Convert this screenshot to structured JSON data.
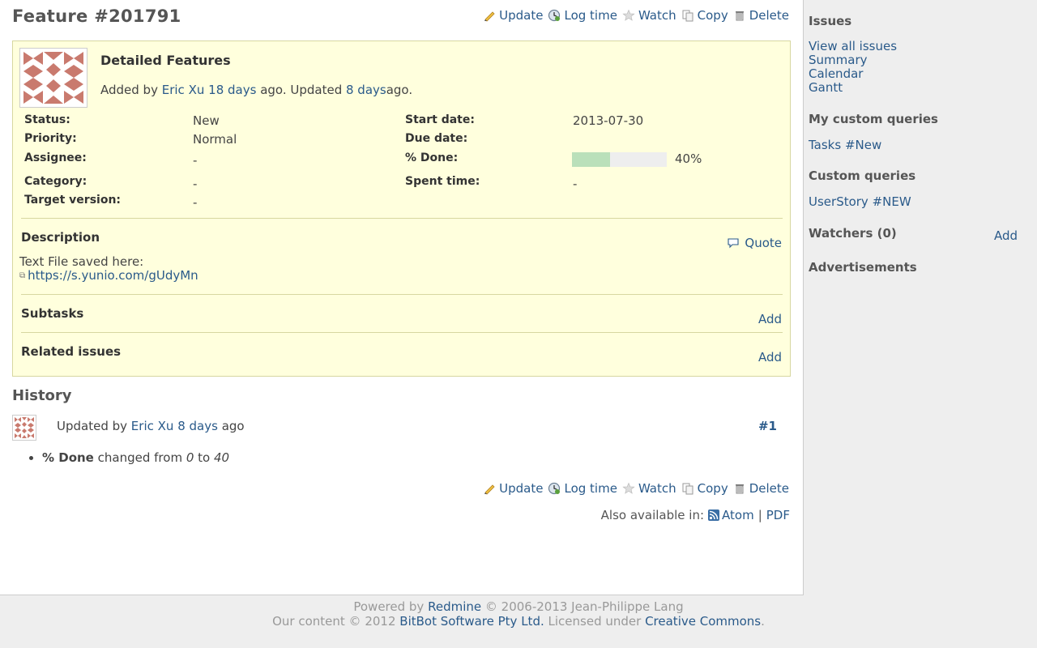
{
  "issue": {
    "title": "Feature #201791",
    "subject": "Detailed Features",
    "author": {
      "prefix": "Added by",
      "name": "Eric Xu",
      "created": "18 days",
      "mid": "ago. Updated",
      "updated": "8 days",
      "suffix": "ago."
    },
    "attributes": {
      "status_label": "Status:",
      "status": "New",
      "priority_label": "Priority:",
      "priority": "Normal",
      "assignee_label": "Assignee:",
      "assignee": "-",
      "category_label": "Category:",
      "category": "-",
      "target_version_label": "Target version:",
      "target_version": "-",
      "start_date_label": "Start date:",
      "start_date": "2013-07-30",
      "due_date_label": "Due date:",
      "due_date": "",
      "done_label": "% Done:",
      "done_text": "40%",
      "done_fraction": 0.4,
      "spent_label": "Spent time:",
      "spent": "-"
    },
    "description": {
      "heading": "Description",
      "quote": "Quote",
      "text": "Text File saved here:",
      "link": "https://s.yunio.com/gUdyMn"
    },
    "subtasks": {
      "heading": "Subtasks",
      "add": "Add"
    },
    "related": {
      "heading": "Related issues",
      "add": "Add"
    }
  },
  "actions": {
    "update": "Update",
    "log_time": "Log time",
    "watch": "Watch",
    "copy": "Copy",
    "delete": "Delete"
  },
  "history": {
    "heading": "History",
    "entry": {
      "prefix": "Updated by",
      "author": "Eric Xu",
      "ago": "8 days",
      "suffix": "ago",
      "number": "#1",
      "field": "% Done",
      "changed": "changed from",
      "from": "0",
      "to_word": "to",
      "to": "40"
    }
  },
  "also_available": {
    "label": "Also available in:",
    "atom": "Atom",
    "sep": "|",
    "pdf": "PDF"
  },
  "sidebar": {
    "issues_heading": "Issues",
    "issue_links": [
      "View all issues",
      "Summary",
      "Calendar",
      "Gantt"
    ],
    "my_queries_heading": "My custom queries",
    "my_queries": [
      "Tasks #New"
    ],
    "custom_queries_heading": "Custom queries",
    "custom_queries": [
      "UserStory #NEW"
    ],
    "watchers_heading": "Watchers (0)",
    "watchers_add": "Add",
    "ads_heading": "Advertisements"
  },
  "footer": {
    "powered_by": "Powered by",
    "redmine": "Redmine",
    "copyright": "© 2006-2013 Jean-Philippe Lang",
    "content": "Our content © 2012",
    "company": "BitBot Software Pty Ltd.",
    "licensed": "Licensed under",
    "license": "Creative Commons",
    "period": "."
  },
  "colors": {
    "link": "#2a5a8a",
    "issue_background": "#ffffdd",
    "progress_done": "#bae0ba",
    "progress_todo": "#eeeeee",
    "avatar": "#c97a6e"
  },
  "icons": {
    "update": "pencil-icon",
    "log_time": "clock-icon",
    "watch": "star-icon",
    "copy": "copy-icon",
    "delete": "trash-icon",
    "quote": "speech-bubble-icon",
    "external": "external-link-icon",
    "feed": "feed-icon"
  }
}
